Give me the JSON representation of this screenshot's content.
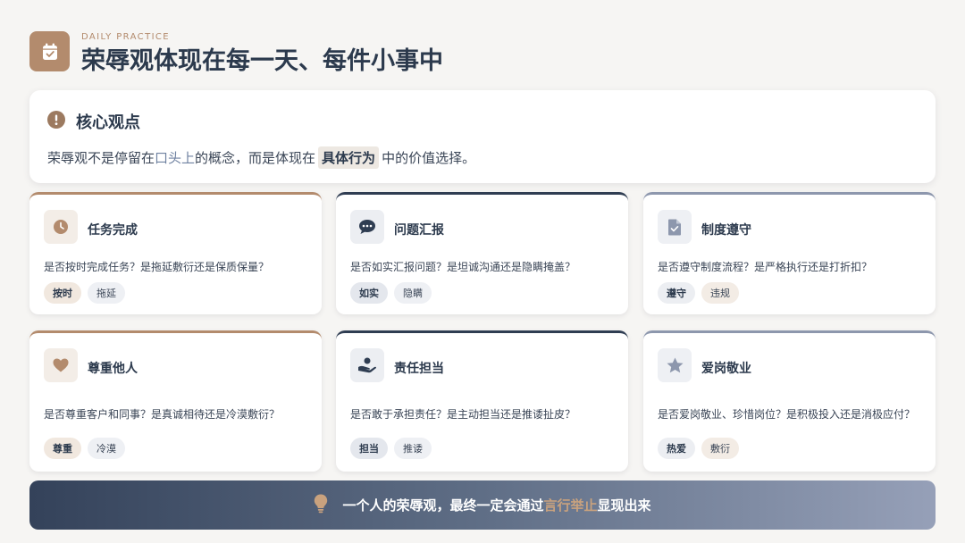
{
  "header": {
    "eyebrow": "DAILY PRACTICE",
    "title": "荣辱观体现在每一天、每件小事中",
    "logo_icon": "calendar-check-icon"
  },
  "core": {
    "icon": "exclamation-circle-icon",
    "title": "核心观点",
    "text_before": "荣辱观不是停留在",
    "highlight1": "口头上",
    "text_middle": "的概念，而是体现在",
    "highlight2": "具体行为",
    "text_after": "中的价值选择。"
  },
  "cards": [
    {
      "title": "任务完成",
      "icon": "clock-icon",
      "question": "是否按时完成任务？是拖延敷衍还是保质保量？",
      "tag_positive": "按时",
      "tag_negative": "拖延"
    },
    {
      "title": "问题汇报",
      "icon": "chat-bubble-icon",
      "question": "是否如实汇报问题？是坦诚沟通还是隐瞒掩盖？",
      "tag_positive": "如实",
      "tag_negative": "隐瞒"
    },
    {
      "title": "制度遵守",
      "icon": "document-icon",
      "question": "是否遵守制度流程？是严格执行还是打折扣？",
      "tag_positive": "遵守",
      "tag_negative": "违规"
    },
    {
      "title": "尊重他人",
      "icon": "heart-icon",
      "question": "是否尊重客户和同事？是真诚相待还是冷漠敷衍？",
      "tag_positive": "尊重",
      "tag_negative": "冷漠"
    },
    {
      "title": "责任担当",
      "icon": "hand-holding-icon",
      "question": "是否敢于承担责任？是主动担当还是推诿扯皮？",
      "tag_positive": "担当",
      "tag_negative": "推诿"
    },
    {
      "title": "爱岗敬业",
      "icon": "star-icon",
      "question": "是否爱岗敬业、珍惜岗位？是积极投入还是消极应付？",
      "tag_positive": "热爱",
      "tag_negative": "敷衍"
    }
  ],
  "banner": {
    "icon": "lightbulb-icon",
    "text_before": "一个人的荣辱观，最终一定会通过",
    "highlight": "言行举止",
    "text_after": "显现出来"
  },
  "colors": {
    "accent_tan": "#b38b6d",
    "navy": "#2f3d52",
    "slate": "#8d97ad",
    "background": "#f6f5f3"
  }
}
